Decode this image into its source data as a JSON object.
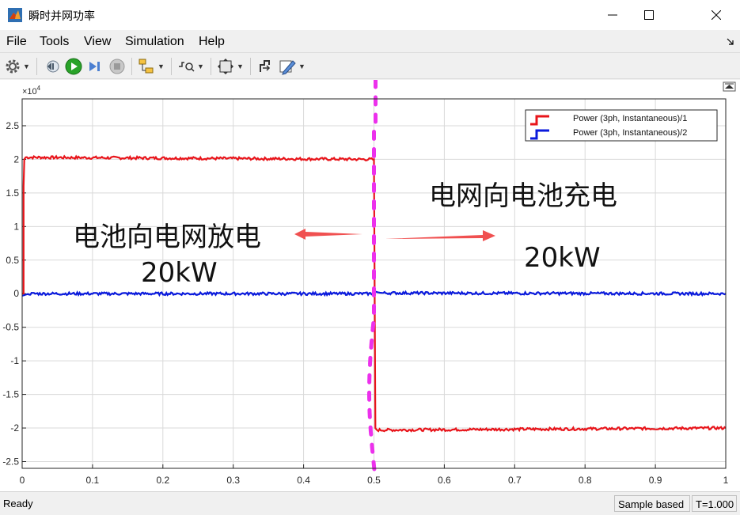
{
  "window": {
    "title": "瞬时并网功率"
  },
  "menu": {
    "file": "File",
    "tools": "Tools",
    "view": "View",
    "simulation": "Simulation",
    "help": "Help"
  },
  "toolbar": {
    "icons": [
      "gear-icon",
      "step-back-icon",
      "run-icon",
      "step-forward-icon",
      "stop-icon",
      "signal-selector-icon",
      "trigger-icon",
      "zoom-fit-icon",
      "cursor-icon",
      "edit-icon"
    ]
  },
  "colors": {
    "series1": "#e8141a",
    "series2": "#0a1adc",
    "annotation_arrow": "#f05050",
    "marker": "#ec30ec"
  },
  "chart_data": {
    "type": "line",
    "y_exponent_label": "×10",
    "y_exponent_power": "4",
    "xlim": [
      0,
      1
    ],
    "ylim": [
      -2.6,
      2.9
    ],
    "x_ticks": [
      0,
      0.1,
      0.2,
      0.3,
      0.4,
      0.5,
      0.6,
      0.7,
      0.8,
      0.9,
      1
    ],
    "x_tick_labels": [
      "0",
      "0.1",
      "0.2",
      "0.3",
      "0.4",
      "0.5",
      "0.6",
      "0.7",
      "0.8",
      "0.9",
      "1"
    ],
    "y_ticks": [
      -2.5,
      -2,
      -1.5,
      -1,
      -0.5,
      0,
      0.5,
      1,
      1.5,
      2,
      2.5
    ],
    "y_tick_labels": [
      "-2.5",
      "-2",
      "-1.5",
      "-1",
      "-0.5",
      "0",
      "0.5",
      "1",
      "1.5",
      "2",
      "2.5"
    ],
    "grid": true,
    "legend_position": "top-right",
    "series": [
      {
        "name": "Power (3ph, Instantaneous)/1",
        "color": "#e8141a",
        "x": [
          0,
          0.002,
          0.002,
          0.003,
          0.005,
          0.5,
          0.502,
          0.503,
          1.0
        ],
        "y": [
          0,
          0,
          1.6,
          2.0,
          2.03,
          2.0,
          -2.0,
          -2.03,
          -2.0
        ]
      },
      {
        "name": "Power (3ph, Instantaneous)/2",
        "color": "#0a1adc",
        "x": [
          0,
          0.01,
          0.5,
          0.502,
          0.51,
          1.0
        ],
        "y": [
          -0.03,
          0.0,
          0.0,
          0.03,
          0.01,
          0.0
        ]
      }
    ],
    "annotations": {
      "left_text": "电池向电网放电",
      "left_value": "20kW",
      "right_text": "电网向电池充电",
      "right_value": "20kW",
      "marker_x": 0.5
    }
  },
  "status": {
    "text": "Ready",
    "mode": "Sample based",
    "time": "T=1.000"
  }
}
